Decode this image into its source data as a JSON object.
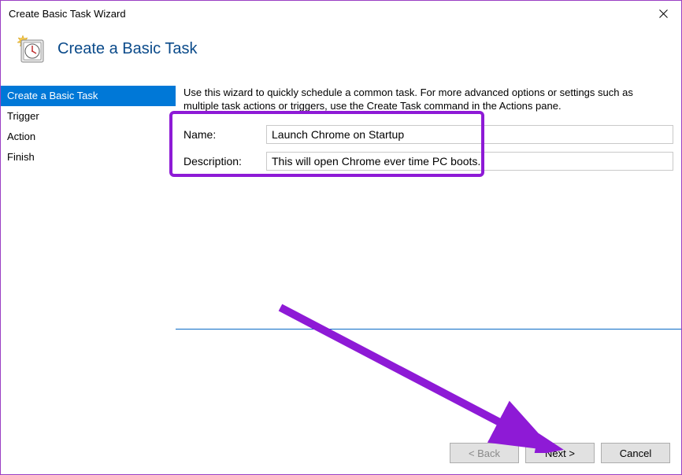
{
  "window": {
    "title": "Create Basic Task Wizard"
  },
  "header": {
    "title": "Create a Basic Task"
  },
  "sidebar": {
    "steps": [
      {
        "label": "Create a Basic Task",
        "active": true
      },
      {
        "label": "Trigger",
        "active": false
      },
      {
        "label": "Action",
        "active": false
      },
      {
        "label": "Finish",
        "active": false
      }
    ]
  },
  "main": {
    "instructions": "Use this wizard to quickly schedule a common task.  For more advanced options or settings such as multiple task actions or triggers, use the Create Task command in the Actions pane.",
    "name_label": "Name:",
    "name_value": "Launch Chrome on Startup",
    "description_label": "Description:",
    "description_value": "This will open Chrome ever time PC boots."
  },
  "footer": {
    "back": "< Back",
    "next": "Next >",
    "cancel": "Cancel"
  },
  "annotation": {
    "highlight_color": "#8e1ad6"
  }
}
